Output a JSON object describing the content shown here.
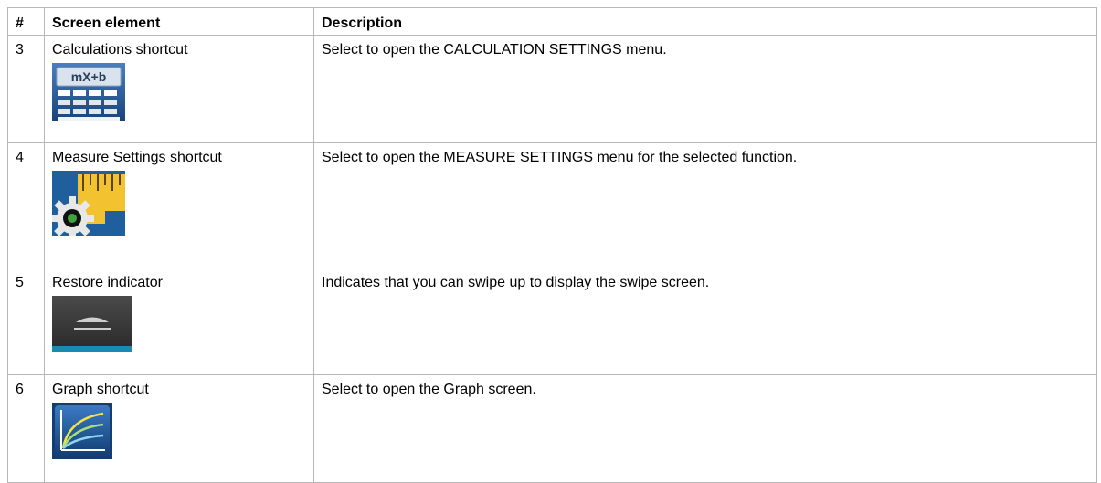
{
  "table": {
    "headers": {
      "num": "#",
      "element": "Screen element",
      "description": "Description"
    },
    "rows": [
      {
        "num": "3",
        "element": "Calculations shortcut",
        "description": "Select to open the CALCULATION SETTINGS menu.",
        "icon": "calculator-icon",
        "icon_text": "mX+b"
      },
      {
        "num": "4",
        "element": "Measure Settings shortcut",
        "description": "Select to open the MEASURE SETTINGS menu for the selected function.",
        "icon": "ruler-gear-icon"
      },
      {
        "num": "5",
        "element": "Restore indicator",
        "description": "Indicates that you can swipe up to display the swipe screen.",
        "icon": "swipe-up-indicator-icon"
      },
      {
        "num": "6",
        "element": "Graph shortcut",
        "description": "Select to open the Graph screen.",
        "icon": "graph-icon"
      }
    ]
  },
  "colors": {
    "border": "#b7b7b7",
    "icon_blue": "#1f5f9e",
    "icon_yellow": "#f2c230",
    "indicator_bar": "#1a8ab0"
  }
}
